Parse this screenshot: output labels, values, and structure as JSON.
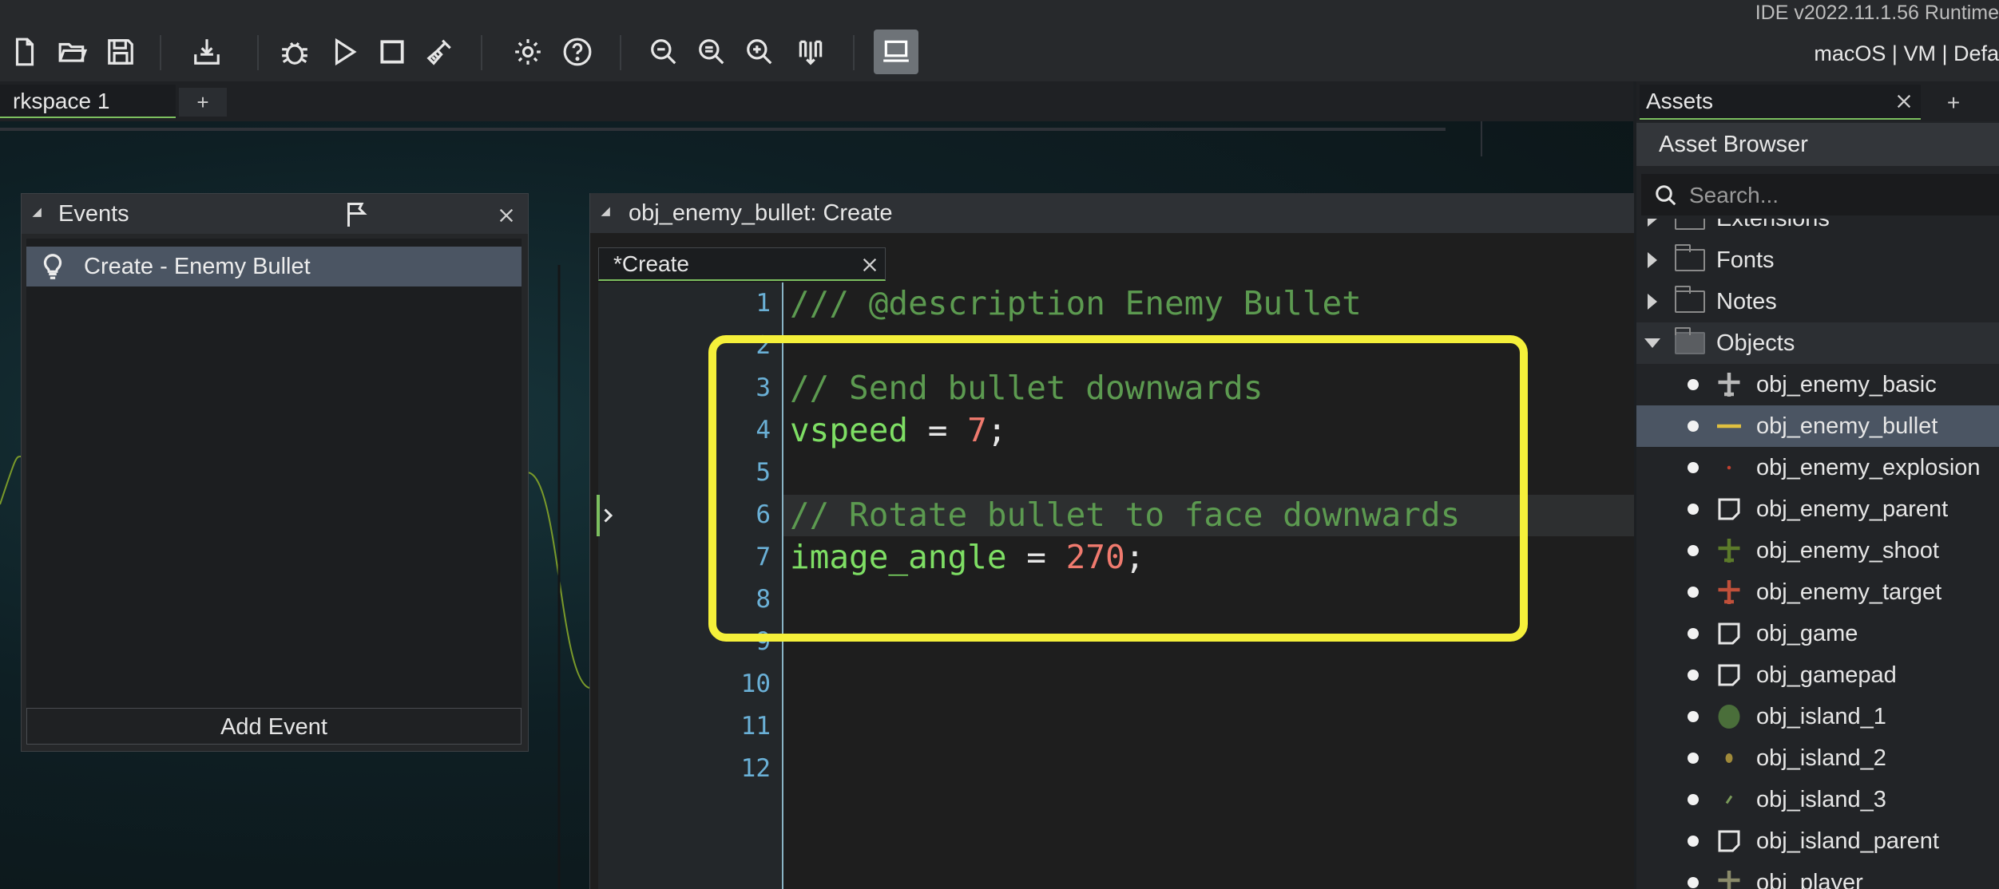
{
  "header": {
    "version_text": "IDE v2022.11.1.56  Runtime",
    "target_text": "macOS | VM | Defa"
  },
  "workspace_tabs": [
    {
      "label": "rkspace 1"
    }
  ],
  "workspace_add_label": "+",
  "events_panel": {
    "title": "Events",
    "items": [
      {
        "label": "Create - Enemy Bullet"
      }
    ],
    "add_event_label": "Add Event"
  },
  "editor": {
    "title": "obj_enemy_bullet: Create",
    "tab_label": "*Create",
    "line_numbers": [
      "1",
      "2",
      "3",
      "4",
      "5",
      "6",
      "7",
      "8",
      "9",
      "10",
      "11",
      "12"
    ],
    "lines": {
      "l1": "/// @description Enemy Bullet",
      "l3": "// Send bullet downwards",
      "l4_var": "vspeed",
      "l4_op": " = ",
      "l4_num": "7",
      "l4_end": ";",
      "l6": "// Rotate bullet to face downwards",
      "l7_var": "image_angle",
      "l7_op": " = ",
      "l7_num": "270",
      "l7_end": ";"
    },
    "highlight_color": "#f5f03a"
  },
  "assets_panel": {
    "tab_label": "Assets",
    "add_label": "+",
    "browser_title": "Asset Browser",
    "search_placeholder": "Search...",
    "folders": [
      {
        "label": "Extensions"
      },
      {
        "label": "Fonts"
      },
      {
        "label": "Notes"
      },
      {
        "label": "Objects"
      }
    ],
    "objects": [
      {
        "label": "obj_enemy_basic"
      },
      {
        "label": "obj_enemy_bullet"
      },
      {
        "label": "obj_enemy_explosion"
      },
      {
        "label": "obj_enemy_parent"
      },
      {
        "label": "obj_enemy_shoot"
      },
      {
        "label": "obj_enemy_target"
      },
      {
        "label": "obj_game"
      },
      {
        "label": "obj_gamepad"
      },
      {
        "label": "obj_island_1"
      },
      {
        "label": "obj_island_2"
      },
      {
        "label": "obj_island_3"
      },
      {
        "label": "obj_island_parent"
      },
      {
        "label": "obj_player"
      }
    ]
  },
  "colors": {
    "accent_green": "#7cbf5f",
    "selection": "#4b5563",
    "line_number": "#6ab0d6"
  }
}
